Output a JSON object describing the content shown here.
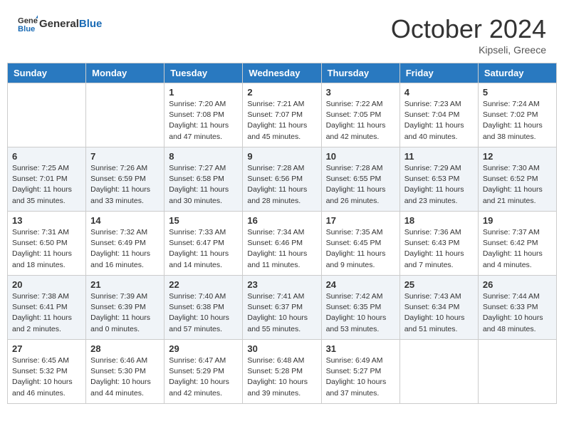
{
  "header": {
    "logo_line1": "General",
    "logo_line2": "Blue",
    "month": "October 2024",
    "location": "Kipseli, Greece"
  },
  "days_of_week": [
    "Sunday",
    "Monday",
    "Tuesday",
    "Wednesday",
    "Thursday",
    "Friday",
    "Saturday"
  ],
  "weeks": [
    [
      {
        "day": "",
        "info": ""
      },
      {
        "day": "",
        "info": ""
      },
      {
        "day": "1",
        "info": "Sunrise: 7:20 AM\nSunset: 7:08 PM\nDaylight: 11 hours and 47 minutes."
      },
      {
        "day": "2",
        "info": "Sunrise: 7:21 AM\nSunset: 7:07 PM\nDaylight: 11 hours and 45 minutes."
      },
      {
        "day": "3",
        "info": "Sunrise: 7:22 AM\nSunset: 7:05 PM\nDaylight: 11 hours and 42 minutes."
      },
      {
        "day": "4",
        "info": "Sunrise: 7:23 AM\nSunset: 7:04 PM\nDaylight: 11 hours and 40 minutes."
      },
      {
        "day": "5",
        "info": "Sunrise: 7:24 AM\nSunset: 7:02 PM\nDaylight: 11 hours and 38 minutes."
      }
    ],
    [
      {
        "day": "6",
        "info": "Sunrise: 7:25 AM\nSunset: 7:01 PM\nDaylight: 11 hours and 35 minutes."
      },
      {
        "day": "7",
        "info": "Sunrise: 7:26 AM\nSunset: 6:59 PM\nDaylight: 11 hours and 33 minutes."
      },
      {
        "day": "8",
        "info": "Sunrise: 7:27 AM\nSunset: 6:58 PM\nDaylight: 11 hours and 30 minutes."
      },
      {
        "day": "9",
        "info": "Sunrise: 7:28 AM\nSunset: 6:56 PM\nDaylight: 11 hours and 28 minutes."
      },
      {
        "day": "10",
        "info": "Sunrise: 7:28 AM\nSunset: 6:55 PM\nDaylight: 11 hours and 26 minutes."
      },
      {
        "day": "11",
        "info": "Sunrise: 7:29 AM\nSunset: 6:53 PM\nDaylight: 11 hours and 23 minutes."
      },
      {
        "day": "12",
        "info": "Sunrise: 7:30 AM\nSunset: 6:52 PM\nDaylight: 11 hours and 21 minutes."
      }
    ],
    [
      {
        "day": "13",
        "info": "Sunrise: 7:31 AM\nSunset: 6:50 PM\nDaylight: 11 hours and 18 minutes."
      },
      {
        "day": "14",
        "info": "Sunrise: 7:32 AM\nSunset: 6:49 PM\nDaylight: 11 hours and 16 minutes."
      },
      {
        "day": "15",
        "info": "Sunrise: 7:33 AM\nSunset: 6:47 PM\nDaylight: 11 hours and 14 minutes."
      },
      {
        "day": "16",
        "info": "Sunrise: 7:34 AM\nSunset: 6:46 PM\nDaylight: 11 hours and 11 minutes."
      },
      {
        "day": "17",
        "info": "Sunrise: 7:35 AM\nSunset: 6:45 PM\nDaylight: 11 hours and 9 minutes."
      },
      {
        "day": "18",
        "info": "Sunrise: 7:36 AM\nSunset: 6:43 PM\nDaylight: 11 hours and 7 minutes."
      },
      {
        "day": "19",
        "info": "Sunrise: 7:37 AM\nSunset: 6:42 PM\nDaylight: 11 hours and 4 minutes."
      }
    ],
    [
      {
        "day": "20",
        "info": "Sunrise: 7:38 AM\nSunset: 6:41 PM\nDaylight: 11 hours and 2 minutes."
      },
      {
        "day": "21",
        "info": "Sunrise: 7:39 AM\nSunset: 6:39 PM\nDaylight: 11 hours and 0 minutes."
      },
      {
        "day": "22",
        "info": "Sunrise: 7:40 AM\nSunset: 6:38 PM\nDaylight: 10 hours and 57 minutes."
      },
      {
        "day": "23",
        "info": "Sunrise: 7:41 AM\nSunset: 6:37 PM\nDaylight: 10 hours and 55 minutes."
      },
      {
        "day": "24",
        "info": "Sunrise: 7:42 AM\nSunset: 6:35 PM\nDaylight: 10 hours and 53 minutes."
      },
      {
        "day": "25",
        "info": "Sunrise: 7:43 AM\nSunset: 6:34 PM\nDaylight: 10 hours and 51 minutes."
      },
      {
        "day": "26",
        "info": "Sunrise: 7:44 AM\nSunset: 6:33 PM\nDaylight: 10 hours and 48 minutes."
      }
    ],
    [
      {
        "day": "27",
        "info": "Sunrise: 6:45 AM\nSunset: 5:32 PM\nDaylight: 10 hours and 46 minutes."
      },
      {
        "day": "28",
        "info": "Sunrise: 6:46 AM\nSunset: 5:30 PM\nDaylight: 10 hours and 44 minutes."
      },
      {
        "day": "29",
        "info": "Sunrise: 6:47 AM\nSunset: 5:29 PM\nDaylight: 10 hours and 42 minutes."
      },
      {
        "day": "30",
        "info": "Sunrise: 6:48 AM\nSunset: 5:28 PM\nDaylight: 10 hours and 39 minutes."
      },
      {
        "day": "31",
        "info": "Sunrise: 6:49 AM\nSunset: 5:27 PM\nDaylight: 10 hours and 37 minutes."
      },
      {
        "day": "",
        "info": ""
      },
      {
        "day": "",
        "info": ""
      }
    ]
  ]
}
